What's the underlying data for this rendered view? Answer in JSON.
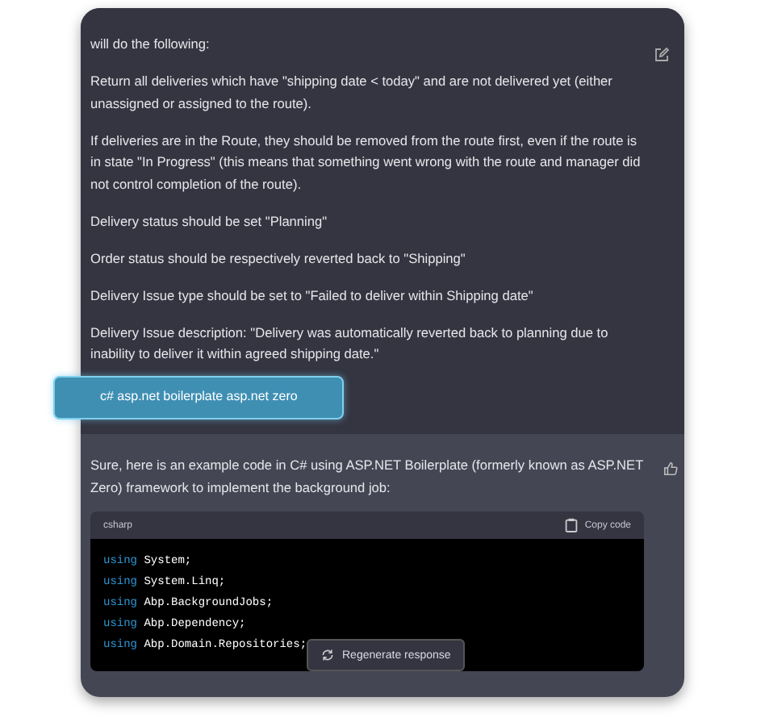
{
  "message": {
    "paragraphs": [
      "will do the following:",
      "Return all deliveries which have \"shipping date < today\" and are not delivered yet (either unassigned or assigned to the route).",
      "If deliveries are in the Route, they should be removed from the route first, even if the route is in state \"In Progress\" (this means that something went wrong with the route and manager did not control completion of the route).",
      "Delivery status should be set \"Planning\"",
      "Order status should be respectively reverted back to \"Shipping\"",
      "Delivery Issue type should be set to \"Failed to deliver within Shipping date\"",
      "Delivery Issue description: \"Delivery was automatically reverted back to planning due to inability to deliver it within agreed shipping date.\""
    ]
  },
  "prompt_highlight": {
    "text": "c# asp.net boilerplate asp.net zero"
  },
  "response": {
    "text": "Sure, here is an example code in C# using ASP.NET Boilerplate (formerly known as ASP.NET Zero) framework to implement the background job:",
    "code_block": {
      "language": "csharp",
      "copy_label": "Copy code",
      "lines": [
        {
          "keyword": "using",
          "rest": "System;"
        },
        {
          "keyword": "using",
          "rest": "System.Linq;"
        },
        {
          "keyword": "using",
          "rest": "Abp.BackgroundJobs;"
        },
        {
          "keyword": "using",
          "rest": "Abp.Dependency;"
        },
        {
          "keyword": "using",
          "rest": "Abp.Domain.Repositories;"
        }
      ]
    }
  },
  "regenerate_button": {
    "label": "Regenerate response"
  }
}
